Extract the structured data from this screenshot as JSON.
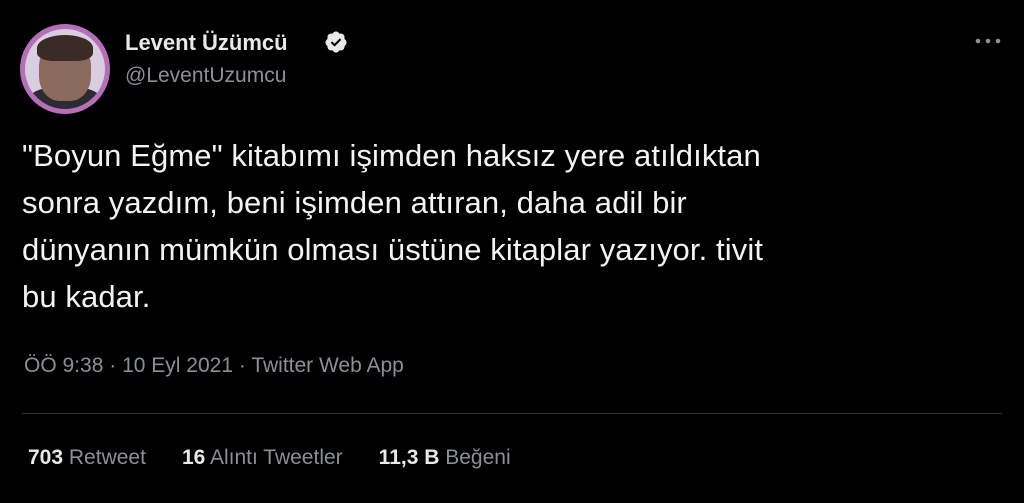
{
  "author": {
    "display_name": "Levent Üzümcü",
    "handle": "@LeventUzumcu",
    "verified": true,
    "verified_badge_color": "#e7e9ea",
    "verified_icon": "verified-badge-icon",
    "avatar_ring_color": "#b56fb8"
  },
  "tweet": {
    "text": "\"Boyun Eğme\" kitabımı işimden haksız yere atıldıktan\nsonra yazdım, beni işimden attıran, daha adil bir\ndünyanın mümkün olması üstüne kitaplar yazıyor. tivit\nbu kadar.",
    "time": "ÖÖ 9:38",
    "separator": "·",
    "date": "10 Eyl 2021",
    "source": "Twitter Web App"
  },
  "stats": {
    "retweets": {
      "count": "703",
      "label": "Retweet"
    },
    "quotes": {
      "count": "16",
      "label": "Alıntı Tweetler"
    },
    "likes": {
      "count": "11,3 B",
      "label": "Beğeni"
    }
  },
  "menu": {
    "icon": "more-icon"
  },
  "theme": {
    "background": "#000000",
    "text": "#e7e9ea",
    "muted": "#8b9096",
    "divider": "#2f3336"
  }
}
